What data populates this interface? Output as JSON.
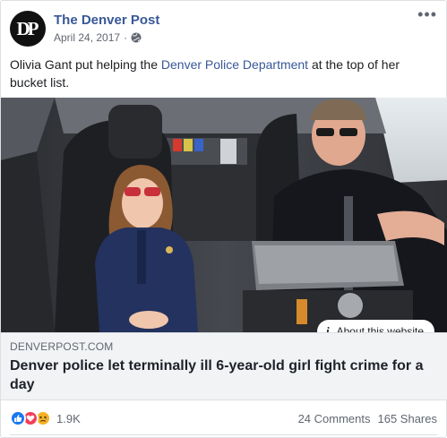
{
  "post": {
    "page_name": "The Denver Post",
    "avatar_text": "DP",
    "date": "April 24, 2017",
    "separator": "·",
    "privacy_icon": "globe-icon",
    "more_label": "•••",
    "text_before": "Olivia Gant put helping the ",
    "text_link": "Denver Police Department",
    "text_after": " at the top of her bucket list."
  },
  "image": {
    "description_icon": "photo"
  },
  "about_website": {
    "icon_label": "i",
    "label": "About this website"
  },
  "link_preview": {
    "domain": "DENVERPOST.COM",
    "title": "Denver police let terminally ill 6-year-old girl fight crime for a day"
  },
  "footer": {
    "reaction_icons": [
      "like-icon",
      "love-icon",
      "sad-icon"
    ],
    "reaction_count": "1.9K",
    "comments": "24 Comments",
    "shares": "165 Shares"
  },
  "colors": {
    "link": "#385898",
    "like": "#1877f2",
    "love": "#f33e58",
    "sad": "#f7b125",
    "muted": "#606770"
  }
}
